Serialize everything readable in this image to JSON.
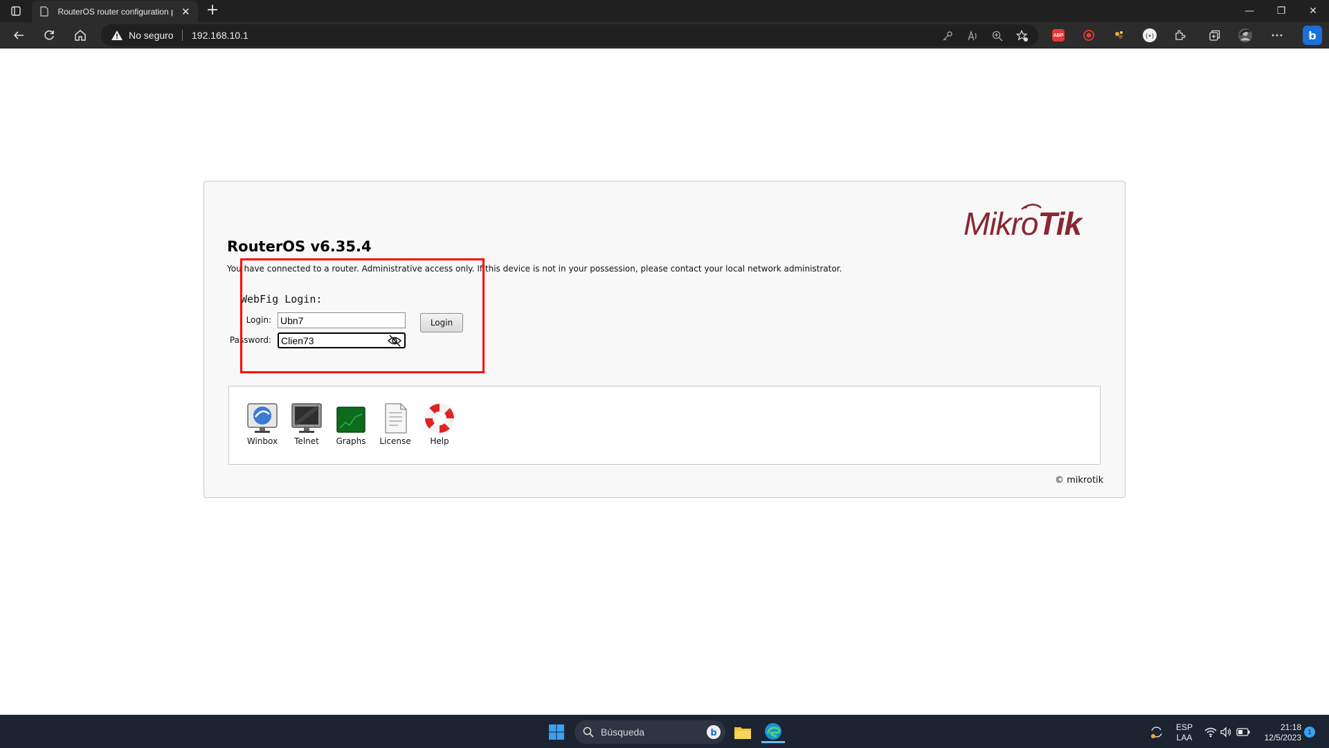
{
  "browser": {
    "tab_title": "RouterOS router configuration p",
    "tab_close": "✕",
    "new_tab": "+",
    "security_label": "No seguro",
    "url": "192.168.10.1",
    "window_controls": {
      "minimize": "—",
      "restore": "❐",
      "close": "✕"
    },
    "ext_abp": "ABP"
  },
  "page": {
    "logo_a": "Mikro",
    "logo_b": "Tik",
    "title": "RouterOS v6.35.4",
    "notice": "You have connected to a router. Administrative access only. If this device is not in your possession, please contact your local network administrator.",
    "webfig_title": "WebFig Login:",
    "login_label": "Login:",
    "login_value": "Ubn7",
    "password_label": "Password:",
    "password_value": "Clien73",
    "login_button": "Login",
    "tools": [
      {
        "label": "Winbox"
      },
      {
        "label": "Telnet"
      },
      {
        "label": "Graphs"
      },
      {
        "label": "License"
      },
      {
        "label": "Help"
      }
    ],
    "copyright": "© mikrotik"
  },
  "taskbar": {
    "search_placeholder": "Búsqueda",
    "lang_1": "ESP",
    "lang_2": "LAA",
    "time": "21:18",
    "date": "12/5/2023",
    "notif_count": "1"
  },
  "colors": {
    "annotation_box": "#ff0000",
    "mikrotik_brand": "#8a2632"
  }
}
